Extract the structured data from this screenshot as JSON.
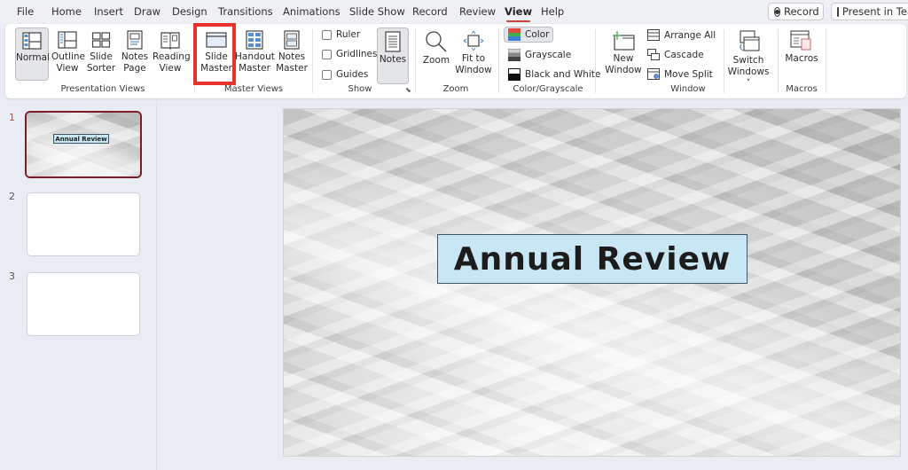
{
  "menu": {
    "tabs": [
      "File",
      "Home",
      "Insert",
      "Draw",
      "Design",
      "Transitions",
      "Animations",
      "Slide Show",
      "Record",
      "Review",
      "View",
      "Help"
    ],
    "active_tab": "View",
    "record_button": "Record",
    "present_button": "Present in Tea"
  },
  "ribbon": {
    "presentation_views": {
      "label": "Presentation Views",
      "buttons": [
        "Normal",
        "Outline\nView",
        "Slide\nSorter",
        "Notes\nPage",
        "Reading\nView"
      ],
      "selected": "Normal"
    },
    "master_views": {
      "label": "Master Views",
      "buttons": [
        "Slide\nMaster",
        "Handout\nMaster",
        "Notes\nMaster"
      ],
      "highlighted": "Slide Master"
    },
    "show": {
      "label": "Show",
      "checkboxes": [
        {
          "label": "Ruler",
          "checked": false
        },
        {
          "label": "Gridlines",
          "checked": false
        },
        {
          "label": "Guides",
          "checked": false
        }
      ],
      "notes_button": "Notes"
    },
    "zoom": {
      "label": "Zoom",
      "buttons": [
        "Zoom",
        "Fit to\nWindow"
      ]
    },
    "color_grayscale": {
      "label": "Color/Grayscale",
      "options": [
        "Color",
        "Grayscale",
        "Black and White"
      ],
      "selected": "Color"
    },
    "window": {
      "label": "Window",
      "new_window": "New\nWindow",
      "options": [
        "Arrange All",
        "Cascade",
        "Move Split"
      ],
      "switch_windows": "Switch\nWindows ˅"
    },
    "macros": {
      "label": "Macros",
      "button": "Macros"
    }
  },
  "slides": [
    {
      "number": "1",
      "title": "Annual Review",
      "selected": true
    },
    {
      "number": "2",
      "title": "",
      "selected": false
    },
    {
      "number": "3",
      "title": "",
      "selected": false
    }
  ],
  "current_slide": {
    "title": "Annual Review"
  },
  "colors": {
    "accent": "#c4443a",
    "highlight_box": "#e8322e",
    "title_fill": "#c9e6f5",
    "selected_thumb_border": "#7a1e24"
  }
}
